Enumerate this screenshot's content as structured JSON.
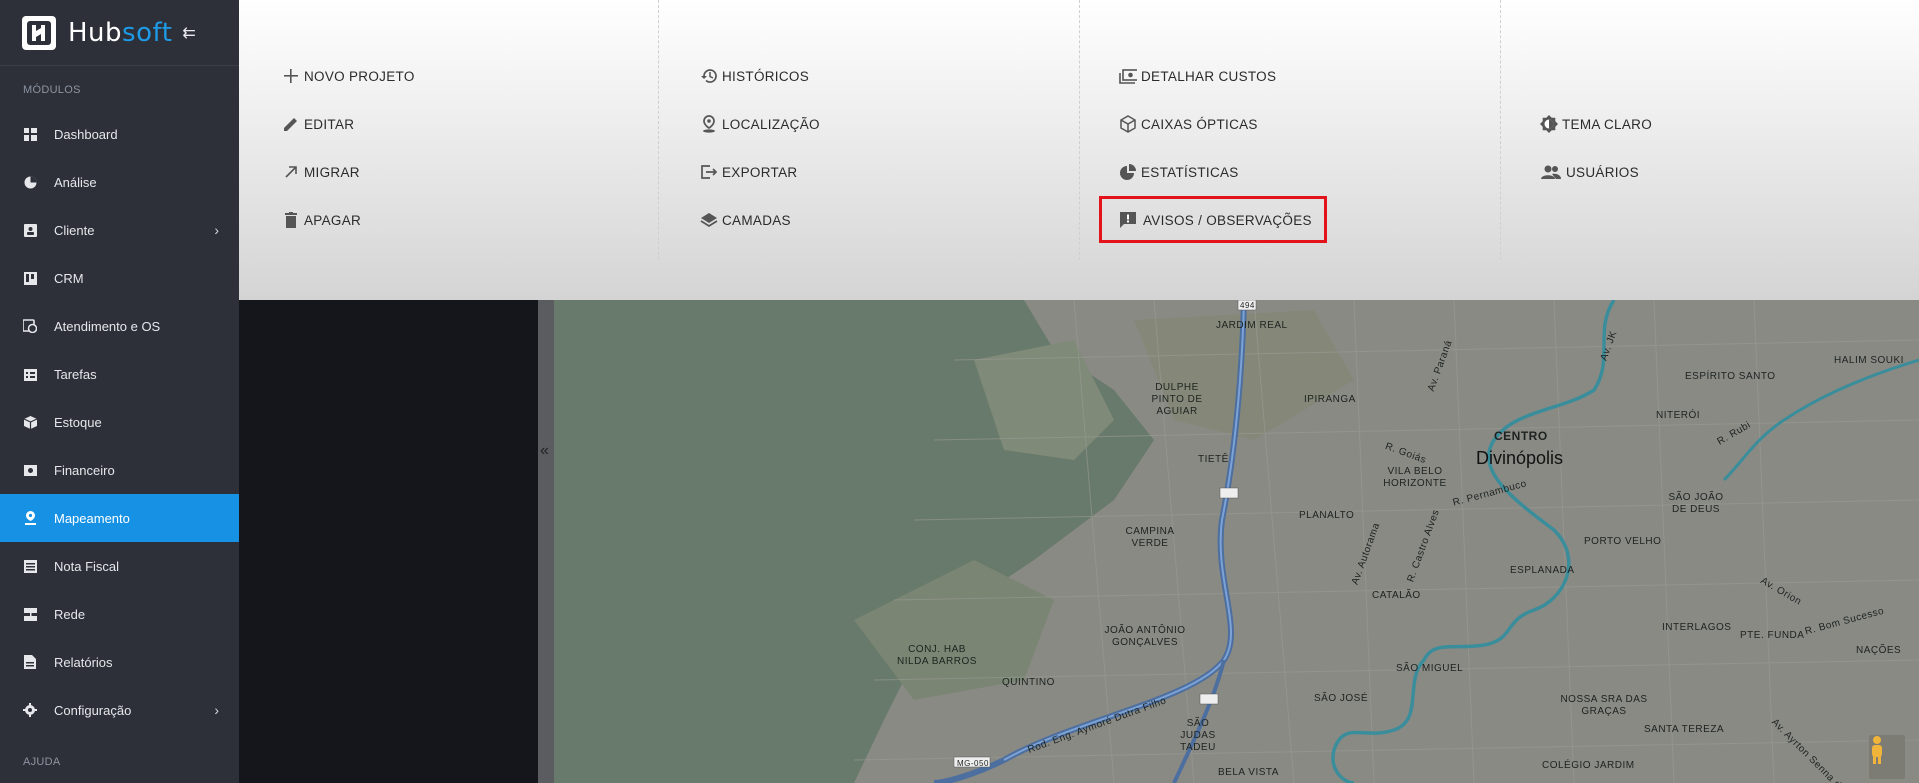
{
  "brand": {
    "name_part1": "Hub",
    "name_part2": "soft",
    "toggle_icon": "menu-collapse-icon"
  },
  "sidebar": {
    "section_modules": "MÓDULOS",
    "items": [
      {
        "label": "Dashboard",
        "icon": "dashboard-icon"
      },
      {
        "label": "Análise",
        "icon": "pie-chart-icon"
      },
      {
        "label": "Cliente",
        "icon": "contact-icon",
        "has_children": true
      },
      {
        "label": "CRM",
        "icon": "board-icon"
      },
      {
        "label": "Atendimento e OS",
        "icon": "calendar-clock-icon"
      },
      {
        "label": "Tarefas",
        "icon": "tasks-icon"
      },
      {
        "label": "Estoque",
        "icon": "box-icon"
      },
      {
        "label": "Financeiro",
        "icon": "money-icon"
      },
      {
        "label": "Mapeamento",
        "icon": "map-pin-icon",
        "active": true
      },
      {
        "label": "Nota Fiscal",
        "icon": "document-icon"
      },
      {
        "label": "Rede",
        "icon": "server-icon"
      },
      {
        "label": "Relatórios",
        "icon": "report-icon"
      },
      {
        "label": "Configuração",
        "icon": "gear-icon",
        "has_children": true
      }
    ],
    "section_help": "AJUDA",
    "active_color": "#1791e3"
  },
  "menu": {
    "col1": [
      {
        "label": "NOVO PROJETO",
        "icon": "plus-icon"
      },
      {
        "label": "EDITAR",
        "icon": "pencil-icon"
      },
      {
        "label": "MIGRAR",
        "icon": "arrow-up-right-icon"
      },
      {
        "label": "APAGAR",
        "icon": "trash-icon"
      }
    ],
    "col2": [
      {
        "label": "HISTÓRICOS",
        "icon": "history-icon"
      },
      {
        "label": "LOCALIZAÇÃO",
        "icon": "location-icon"
      },
      {
        "label": "EXPORTAR",
        "icon": "export-icon"
      },
      {
        "label": "CAMADAS",
        "icon": "layers-icon"
      }
    ],
    "col3": [
      {
        "label": "DETALHAR CUSTOS",
        "icon": "cash-icon"
      },
      {
        "label": "CAIXAS ÓPTICAS",
        "icon": "cube-icon"
      },
      {
        "label": "ESTATÍSTICAS",
        "icon": "pie-chart-icon"
      },
      {
        "label": "AVISOS / OBSERVAÇÕES",
        "icon": "alert-comment-icon",
        "highlighted": true
      }
    ],
    "col4": [
      {
        "label": "TEMA CLARO",
        "icon": "brightness-icon"
      },
      {
        "label": "USUÁRIOS",
        "icon": "users-icon"
      }
    ],
    "highlight_color": "#e3131b"
  },
  "map": {
    "collapse_icon": "«",
    "labels": [
      "JARDIM REAL",
      "DULPHE PINTO DE AGUIAR",
      "IPIRANGA",
      "CENTRO",
      "Divinópolis",
      "TIETÊ",
      "VILA BELO HORIZONTE",
      "PLANALTO",
      "CAMPINA VERDE",
      "ESPLANADA",
      "CATALÃO",
      "JOÃO ANTÔNIO GONÇALVES",
      "CONJ. HAB NILDA BARROS",
      "QUINTINO",
      "SÃO MIGUEL",
      "SÃO JOSÉ",
      "SÃO JUDAS TADEU",
      "BELA VISTA",
      "NOSSA SRA DAS GRAÇAS",
      "COLÉGIO JARDIM",
      "SANTA TEREZA",
      "INTERLAGOS",
      "PTE. FUNDA",
      "NAÇÕES",
      "PORTO VELHO",
      "SÃO JOÃO DE DEUS",
      "NITERÓI",
      "ESPÍRITO SANTO",
      "HALIM SOUKI",
      "R. Goiás",
      "R. Pernambuco",
      "Av. Paraná",
      "Av. Autorama",
      "R. Castro Alves",
      "Av. Orion",
      "R. Bom Sucesso",
      "R. Rubi",
      "Av. JK",
      "494",
      "MG-050",
      "Rod. Eng. Aymoré Dutra Filho",
      "Av. Ayrton Senna da Silva"
    ]
  }
}
